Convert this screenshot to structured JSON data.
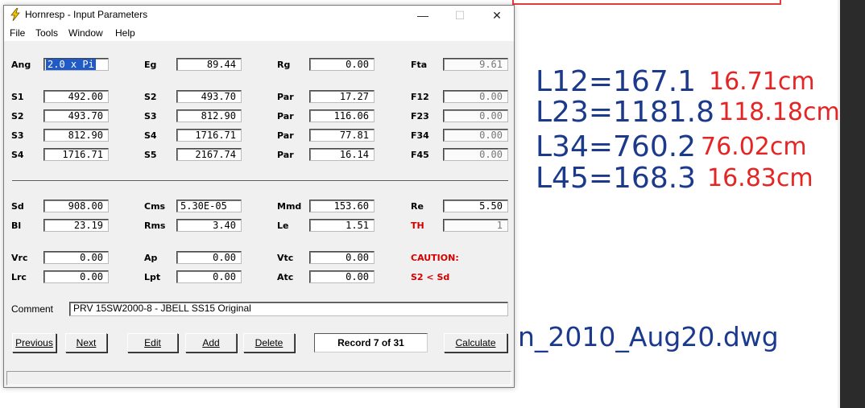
{
  "background": {
    "lines": [
      {
        "length": "L12=167.1",
        "cm": "16.71cm"
      },
      {
        "length": "L23=1181.8",
        "cm": "118.18cm"
      },
      {
        "length": "L34=760.2",
        "cm": "76.02cm"
      },
      {
        "length": "L45=168.3",
        "cm": "16.83cm"
      }
    ],
    "filename": "n_2010_Aug20.dwg"
  },
  "window": {
    "title": "Hornresp - Input Parameters",
    "minimize": "—",
    "maximize": "☐",
    "close": "✕"
  },
  "menu": [
    "File",
    "Tools",
    "Window",
    "Help"
  ],
  "rows1": [
    [
      {
        "label": "Ang",
        "value": "2.0 x Pi",
        "selected": true
      },
      {
        "label": "Eg",
        "value": "89.44"
      },
      {
        "label": "Rg",
        "value": "0.00"
      },
      {
        "label": "Fta",
        "value": "9.61",
        "disabled": true
      }
    ]
  ],
  "rows2": [
    [
      {
        "label": "S1",
        "value": "492.00"
      },
      {
        "label": "S2",
        "value": "493.70"
      },
      {
        "label": "Par",
        "value": "17.27"
      },
      {
        "label": "F12",
        "value": "0.00",
        "disabled": true
      }
    ],
    [
      {
        "label": "S2",
        "value": "493.70"
      },
      {
        "label": "S3",
        "value": "812.90"
      },
      {
        "label": "Par",
        "value": "116.06"
      },
      {
        "label": "F23",
        "value": "0.00",
        "disabled": true
      }
    ],
    [
      {
        "label": "S3",
        "value": "812.90"
      },
      {
        "label": "S4",
        "value": "1716.71"
      },
      {
        "label": "Par",
        "value": "77.81"
      },
      {
        "label": "F34",
        "value": "0.00",
        "disabled": true
      }
    ],
    [
      {
        "label": "S4",
        "value": "1716.71"
      },
      {
        "label": "S5",
        "value": "2167.74"
      },
      {
        "label": "Par",
        "value": "16.14"
      },
      {
        "label": "F45",
        "value": "0.00",
        "disabled": true
      }
    ]
  ],
  "rows3": [
    [
      {
        "label": "Sd",
        "value": "908.00"
      },
      {
        "label": "Cms",
        "value": "5.30E-05",
        "left": true
      },
      {
        "label": "Mmd",
        "value": "153.60"
      },
      {
        "label": "Re",
        "value": "5.50"
      }
    ],
    [
      {
        "label": "Bl",
        "value": "23.19"
      },
      {
        "label": "Rms",
        "value": "3.40"
      },
      {
        "label": "Le",
        "value": "1.51"
      },
      {
        "label": "TH",
        "value": "1",
        "red": true,
        "disabled": true
      }
    ]
  ],
  "rows4": [
    [
      {
        "label": "Vrc",
        "value": "0.00"
      },
      {
        "label": "Ap",
        "value": "0.00"
      },
      {
        "label": "Vtc",
        "value": "0.00"
      }
    ],
    [
      {
        "label": "Lrc",
        "value": "0.00"
      },
      {
        "label": "Lpt",
        "value": "0.00"
      },
      {
        "label": "Atc",
        "value": "0.00"
      }
    ]
  ],
  "caution": {
    "title": "CAUTION:",
    "message": "S2 < Sd",
    "color": "#d40000"
  },
  "comment": {
    "label": "Comment",
    "value": "PRV 15SW2000-8 - JBELL SS15 Original"
  },
  "buttons": {
    "previous": "Previous",
    "next": "Next",
    "edit": "Edit",
    "add": "Add",
    "delete": "Delete",
    "calculate": "Calculate"
  },
  "record": "Record 7 of 31"
}
